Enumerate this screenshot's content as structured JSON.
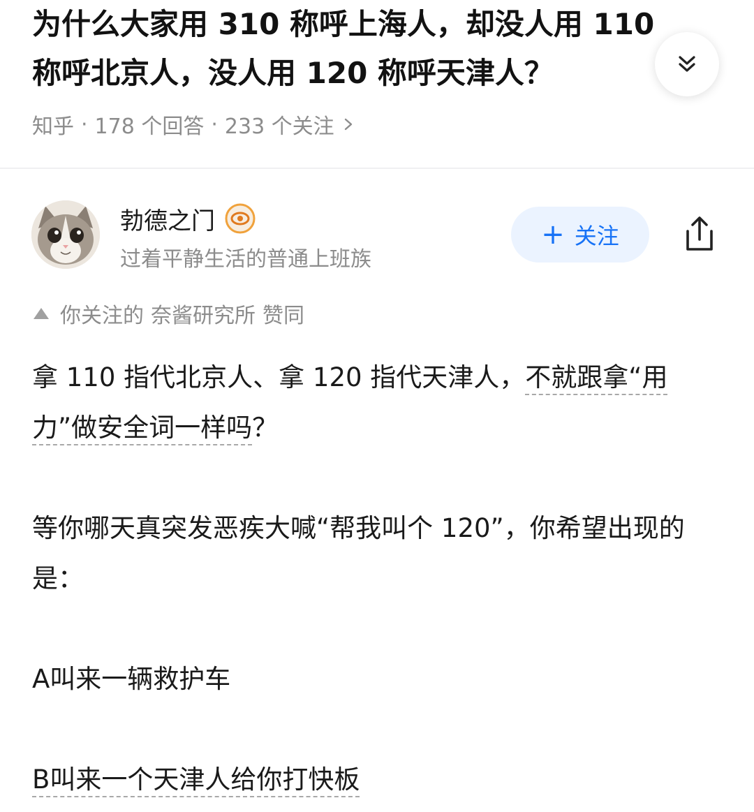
{
  "question": {
    "title": "为什么大家用 310 称呼上海人，却没人用 110 称呼北京人，没人用 120 称呼天津人？",
    "source": "知乎",
    "answers": "178 个回答",
    "followers": "233 个关注"
  },
  "author": {
    "name": "勃德之门",
    "bio": "过着平静生活的普通上班族",
    "follow_label": "关注",
    "avatar_icon": "cat-avatar",
    "badge_icon": "badge-icon"
  },
  "endorsement": {
    "prefix": "你关注的",
    "name": "奈酱研究所",
    "action": "赞同"
  },
  "answer": {
    "p1_a": "拿 110 指代北京人、拿 120 指代天津人，",
    "p1_b": "不就跟拿“用力”做安全词一样吗",
    "p1_c": "？",
    "p2": "等你哪天真突发恶疾大喊“帮我叫个 120”，你希望出现的是：",
    "p3": "A叫来一辆救护车",
    "p4": "B叫来一个天津人给你打快板"
  },
  "colors": {
    "accent": "#1772f6",
    "follow_bg": "#ebf3ff",
    "meta_text": "#8c8c8c"
  }
}
